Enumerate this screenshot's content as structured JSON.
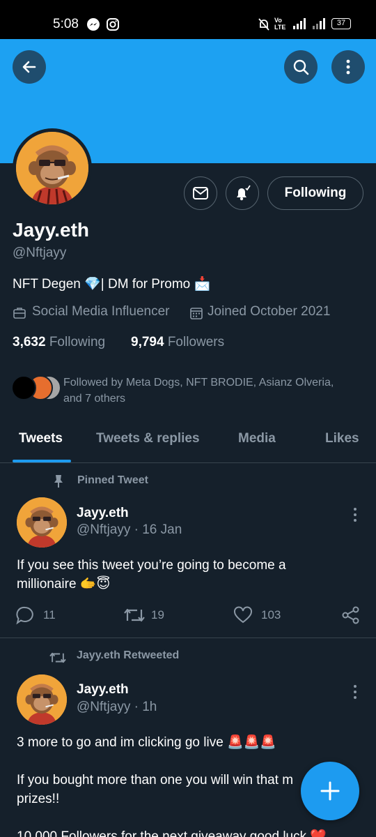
{
  "status_bar": {
    "time": "5:08",
    "volte": "Vo\nLTE",
    "battery": "37"
  },
  "profile": {
    "name": "Jayy.eth",
    "handle": "@Nftjayy",
    "bio": "NFT Degen 💎| DM for Promo 📩",
    "category": "Social Media Influencer",
    "joined": "Joined October 2021",
    "following_count": "3,632",
    "following_label": "Following",
    "followers_count": "9,794",
    "followers_label": "Followers",
    "followed_by_line1": "Followed by Meta Dogs, NFT BRODIE, Asianz Olveria,",
    "followed_by_line2": "and 7 others",
    "following_button": "Following"
  },
  "tabs": [
    {
      "label": "Tweets",
      "active": true
    },
    {
      "label": "Tweets & replies",
      "active": false
    },
    {
      "label": "Media",
      "active": false
    },
    {
      "label": "Likes",
      "active": false
    }
  ],
  "tweets": [
    {
      "context": "Pinned Tweet",
      "name": "Jayy.eth",
      "handle": "@Nftjayy · 16 Jan",
      "text_line1": "If you see this tweet you’re going to become a",
      "text_line2": "millionaire 🫱😇",
      "replies": "11",
      "retweets": "19",
      "likes": "103"
    },
    {
      "context": "Jayy.eth Retweeted",
      "name": "Jayy.eth",
      "handle": "@Nftjayy · 1h",
      "text_line1": "3 more to go and im clicking go live 🚨🚨🚨",
      "text_line2": "If you bought more than one you will win that m",
      "text_line3": "prizes!!",
      "text_line4": "10,000 Followers for the next giveaway good luck ❤️"
    }
  ],
  "colors": {
    "background": "#15202b",
    "banner": "#1da1f2",
    "accent": "#1d9bf0",
    "muted_text": "#8b98a5",
    "divider": "#38444d"
  },
  "icons": [
    "back-arrow-icon",
    "search-icon",
    "more-vertical-icon",
    "mail-icon",
    "bell-icon",
    "briefcase-icon",
    "calendar-icon",
    "pin-icon",
    "retweet-icon",
    "reply-icon",
    "like-icon",
    "share-icon",
    "compose-plus-icon"
  ]
}
